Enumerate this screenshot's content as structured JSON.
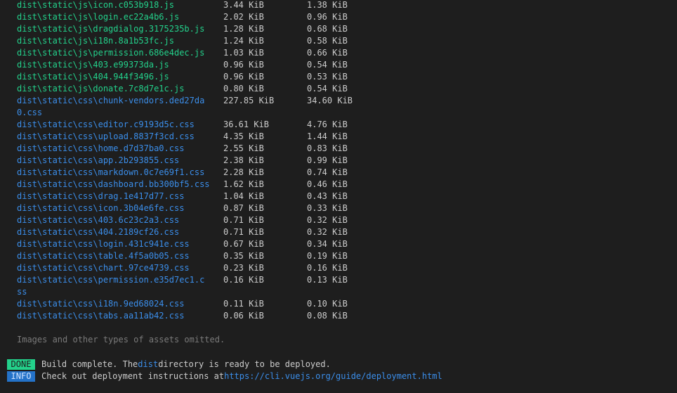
{
  "terminal": {
    "assets": [
      {
        "file": "dist\\static\\js\\icon.c053b918.js",
        "size": "3.44 KiB",
        "gzip": "1.38 KiB",
        "kind": "js"
      },
      {
        "file": "dist\\static\\js\\login.ec22a4b6.js",
        "size": "2.02 KiB",
        "gzip": "0.96 KiB",
        "kind": "js"
      },
      {
        "file": "dist\\static\\js\\dragdialog.3175235b.js",
        "size": "1.28 KiB",
        "gzip": "0.68 KiB",
        "kind": "js"
      },
      {
        "file": "dist\\static\\js\\i18n.8a1b53fc.js",
        "size": "1.24 KiB",
        "gzip": "0.58 KiB",
        "kind": "js"
      },
      {
        "file": "dist\\static\\js\\permission.686e4dec.js",
        "size": "1.03 KiB",
        "gzip": "0.66 KiB",
        "kind": "js"
      },
      {
        "file": "dist\\static\\js\\403.e99373da.js",
        "size": "0.96 KiB",
        "gzip": "0.54 KiB",
        "kind": "js"
      },
      {
        "file": "dist\\static\\js\\404.944f3496.js",
        "size": "0.96 KiB",
        "gzip": "0.53 KiB",
        "kind": "js"
      },
      {
        "file": "dist\\static\\js\\donate.7c8d7e1c.js",
        "size": "0.80 KiB",
        "gzip": "0.54 KiB",
        "kind": "js"
      },
      {
        "file": "dist\\static\\css\\chunk-vendors.ded27da0.css",
        "size": "227.85 KiB",
        "gzip": "34.60 KiB",
        "kind": "css",
        "wrap": true
      },
      {
        "file": "dist\\static\\css\\editor.c9193d5c.css",
        "size": "36.61 KiB",
        "gzip": "4.76 KiB",
        "kind": "css"
      },
      {
        "file": "dist\\static\\css\\upload.8837f3cd.css",
        "size": "4.35 KiB",
        "gzip": "1.44 KiB",
        "kind": "css"
      },
      {
        "file": "dist\\static\\css\\home.d7d37ba0.css",
        "size": "2.55 KiB",
        "gzip": "0.83 KiB",
        "kind": "css"
      },
      {
        "file": "dist\\static\\css\\app.2b293855.css",
        "size": "2.38 KiB",
        "gzip": "0.99 KiB",
        "kind": "css"
      },
      {
        "file": "dist\\static\\css\\markdown.0c7e69f1.css",
        "size": "2.28 KiB",
        "gzip": "0.74 KiB",
        "kind": "css"
      },
      {
        "file": "dist\\static\\css\\dashboard.bb300bf5.css",
        "size": "1.62 KiB",
        "gzip": "0.46 KiB",
        "kind": "css"
      },
      {
        "file": "dist\\static\\css\\drag.1e417d77.css",
        "size": "1.04 KiB",
        "gzip": "0.43 KiB",
        "kind": "css"
      },
      {
        "file": "dist\\static\\css\\icon.3b04e6fe.css",
        "size": "0.87 KiB",
        "gzip": "0.33 KiB",
        "kind": "css"
      },
      {
        "file": "dist\\static\\css\\403.6c23c2a3.css",
        "size": "0.71 KiB",
        "gzip": "0.32 KiB",
        "kind": "css"
      },
      {
        "file": "dist\\static\\css\\404.2189cf26.css",
        "size": "0.71 KiB",
        "gzip": "0.32 KiB",
        "kind": "css"
      },
      {
        "file": "dist\\static\\css\\login.431c941e.css",
        "size": "0.67 KiB",
        "gzip": "0.34 KiB",
        "kind": "css"
      },
      {
        "file": "dist\\static\\css\\table.4f5a0b05.css",
        "size": "0.35 KiB",
        "gzip": "0.19 KiB",
        "kind": "css"
      },
      {
        "file": "dist\\static\\css\\chart.97ce4739.css",
        "size": "0.23 KiB",
        "gzip": "0.16 KiB",
        "kind": "css"
      },
      {
        "file": "dist\\static\\css\\permission.e35d7ec1.css",
        "size": "0.16 KiB",
        "gzip": "0.13 KiB",
        "kind": "css",
        "wrap": true
      },
      {
        "file": "dist\\static\\css\\i18n.9ed68024.css",
        "size": "0.11 KiB",
        "gzip": "0.10 KiB",
        "kind": "css"
      },
      {
        "file": "dist\\static\\css\\tabs.aa11ab42.css",
        "size": "0.06 KiB",
        "gzip": "0.08 KiB",
        "kind": "css"
      }
    ],
    "omitted_note": "Images and other types of assets omitted.",
    "done_badge": "DONE",
    "done_text_before": "Build complete. The ",
    "done_text_highlight": "dist",
    "done_text_after": " directory is ready to be deployed.",
    "info_badge": "INFO",
    "info_text": "Check out deployment instructions at ",
    "info_link": "https://cli.vuejs.org/guide/deployment.html"
  },
  "colors": {
    "background": "#1e1e1e",
    "js_file": "#23d18b",
    "css_file": "#3b8eea",
    "done_badge": "#23d18b",
    "info_badge": "#2472c8",
    "muted": "#7a7a7a"
  }
}
